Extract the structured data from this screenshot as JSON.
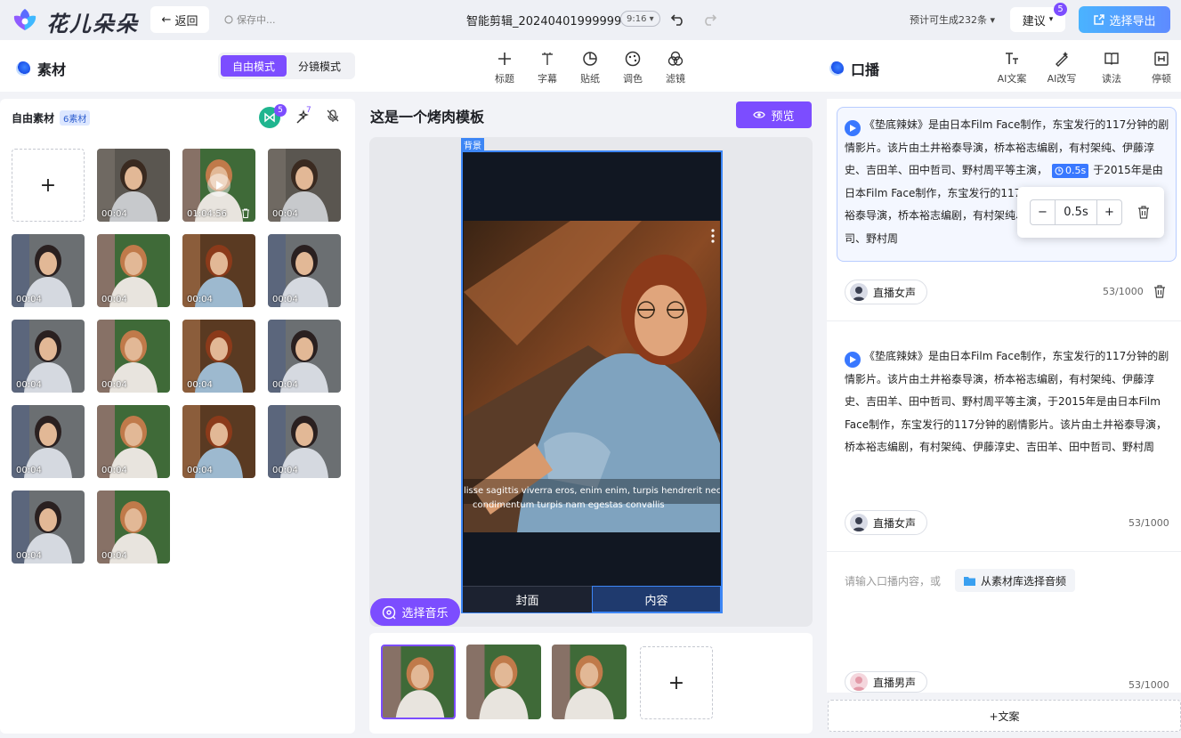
{
  "header": {
    "logo_text": "花儿朵朵",
    "back_label": "返回",
    "save_status": "保存中...",
    "file_name": "智能剪辑_20240401999999",
    "ratio": "9:16",
    "estimate": "预计可生成232条",
    "suggest_label": "建议",
    "suggest_badge": "5",
    "export_label": "选择导出",
    "colors": {
      "accent": "#7c4dff",
      "export": "#4ab3ff"
    }
  },
  "toolbar": {
    "material_title": "素材",
    "modes": [
      "自由模式",
      "分镜模式"
    ],
    "active_mode": "自由模式",
    "tools": [
      {
        "label": "标题",
        "icon": "plus-icon"
      },
      {
        "label": "字幕",
        "icon": "text-icon"
      },
      {
        "label": "贴纸",
        "icon": "sticker-icon"
      },
      {
        "label": "调色",
        "icon": "palette-icon"
      },
      {
        "label": "滤镜",
        "icon": "filter-icon"
      }
    ],
    "voice_title": "口播",
    "voice_tools": [
      {
        "label": "AI文案",
        "icon": "ai-text-icon"
      },
      {
        "label": "AI改写",
        "icon": "ai-rewrite-icon"
      },
      {
        "label": "读法",
        "icon": "book-icon"
      },
      {
        "label": "停顿",
        "icon": "pause-icon"
      }
    ]
  },
  "left_panel": {
    "title": "自由素材",
    "count_label": "6素材",
    "badge_a": "5",
    "badge_b": "7",
    "add_label": "+",
    "thumbs": [
      {
        "dur": "00:04",
        "v": 0
      },
      {
        "dur": "01:04:56",
        "v": 1
      },
      {
        "dur": "00:04",
        "v": 0
      },
      {
        "dur": "00:04",
        "v": 2
      },
      {
        "dur": "00:04",
        "v": 1
      },
      {
        "dur": "00:04",
        "v": 3
      },
      {
        "dur": "00:04",
        "v": 2
      },
      {
        "dur": "00:04",
        "v": 2
      },
      {
        "dur": "00:04",
        "v": 1
      },
      {
        "dur": "00:04",
        "v": 3
      },
      {
        "dur": "00:04",
        "v": 2
      },
      {
        "dur": "00:04",
        "v": 2
      },
      {
        "dur": "00:04",
        "v": 1
      },
      {
        "dur": "00:04",
        "v": 3
      },
      {
        "dur": "00:04",
        "v": 2
      },
      {
        "dur": "00:04",
        "v": 2
      },
      {
        "dur": "00:04",
        "v": 1
      }
    ]
  },
  "center": {
    "title": "这是一个烤肉模板",
    "preview_label": "预览",
    "bg_tag": "背景",
    "caption_line1": "lisse sagittis viverra eros, enim enim, turpis hendrerit nec o",
    "caption_line2": "condimentum turpis nam egestas convallis",
    "tab_cover": "封面",
    "tab_content": "内容",
    "music_label": "选择音乐",
    "add_frame": "+"
  },
  "right_panel": {
    "card1_before": "《垫底辣妹》是由日本Film Face制作，东宝发行的117分钟的剧情影片。该片由土井裕泰导演，桥本裕志编剧，有村架纯、伊藤淳史、吉田羊、田中哲司、野村周平等主演，",
    "card1_pause": "0.5s",
    "card1_after": "于2015年是由日本Film Face制作，东宝发行的117分钟的剧情影片。该片由土井裕泰导演，桥本裕志编剧，有村架纯、伊藤淳史、吉田羊、田中哲司、野村周",
    "popover_value": "0.5s",
    "card1_voice": "直播女声",
    "card1_count": "53/1000",
    "card2_text": "《垫底辣妹》是由日本Film Face制作，东宝发行的117分钟的剧情影片。该片由土井裕泰导演，桥本裕志编剧，有村架纯、伊藤淳史、吉田羊、田中哲司、野村周平等主演，于2015年是由日本Film Face制作，东宝发行的117分钟的剧情影片。该片由土井裕泰导演，桥本裕志编剧，有村架纯、伊藤淳史、吉田羊、田中哲司、野村周",
    "card2_voice": "直播女声",
    "card2_count": "53/1000",
    "input_placeholder": "请输入口播内容，或",
    "library_label": "从素材库选择音频",
    "card3_voice": "直播男声",
    "card3_count": "53/1000",
    "add_copy_label": "+文案"
  }
}
